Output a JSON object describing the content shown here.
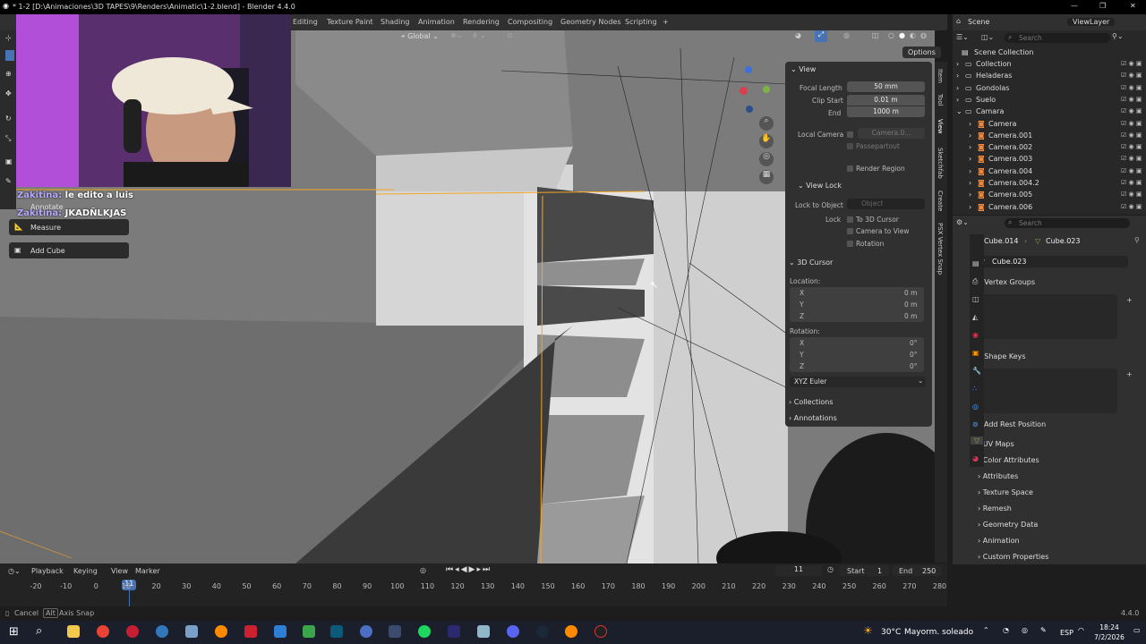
{
  "window": {
    "title": "* 1-2 [D:\\Animaciones\\3D TAPES\\9\\Renders\\Animatic\\1-2.blend] - Blender 4.4.0"
  },
  "workspaces": [
    "Editing",
    "Texture Paint",
    "Shading",
    "Animation",
    "Rendering",
    "Compositing",
    "Geometry Nodes",
    "Scripting",
    "+"
  ],
  "scene": {
    "name": "Scene",
    "view_layer": "ViewLayer"
  },
  "viewport": {
    "transform_orientation": "Global",
    "options_label": "Options"
  },
  "chat": [
    {
      "user": "Zakitina:",
      "msg": "le edito a luis"
    },
    {
      "user": "Zakitina:",
      "msg": "JKADÑLKJAS"
    }
  ],
  "tools": {
    "annotate": "Annotate",
    "measure": "Measure",
    "add_cube": "Add Cube"
  },
  "npanel": {
    "view_title": "View",
    "focal_length_label": "Focal Length",
    "focal_length": "50 mm",
    "clip_start_label": "Clip Start",
    "clip_start": "0.01 m",
    "end_label": "End",
    "end": "1000 m",
    "local_camera_label": "Local Camera",
    "local_camera": "Camera.0...",
    "passepartout": "Passepartout",
    "render_region": "Render Region",
    "view_lock_title": "View Lock",
    "lock_to_object_label": "Lock to Object",
    "lock_to_object": "Object",
    "lock_label": "Lock",
    "to_3d_cursor": "To 3D Cursor",
    "camera_to_view": "Camera to View",
    "rotation": "Rotation",
    "cursor_title": "3D Cursor",
    "location_label": "Location:",
    "loc": [
      {
        "axis": "X",
        "val": "0 m"
      },
      {
        "axis": "Y",
        "val": "0 m"
      },
      {
        "axis": "Z",
        "val": "0 m"
      }
    ],
    "rotation_label": "Rotation:",
    "rot": [
      {
        "axis": "X",
        "val": "0°"
      },
      {
        "axis": "Y",
        "val": "0°"
      },
      {
        "axis": "Z",
        "val": "0°"
      }
    ],
    "euler": "XYZ Euler",
    "collections": "Collections",
    "annotations": "Annotations"
  },
  "side_tabs": [
    "Item",
    "Tool",
    "View",
    "Sketchfab",
    "Create",
    "PSX Vertex Snap"
  ],
  "outliner": {
    "search_placeholder": "Search",
    "root": "Scene Collection",
    "items": [
      {
        "name": "Collection",
        "indent": 1
      },
      {
        "name": "Heladeras",
        "indent": 1
      },
      {
        "name": "Gondolas",
        "indent": 1
      },
      {
        "name": "Suelo",
        "indent": 1
      },
      {
        "name": "Camara",
        "indent": 1
      },
      {
        "name": "Camera",
        "indent": 2
      },
      {
        "name": "Camera.001",
        "indent": 2
      },
      {
        "name": "Camera.002",
        "indent": 2
      },
      {
        "name": "Camera.003",
        "indent": 2
      },
      {
        "name": "Camera.004",
        "indent": 2
      },
      {
        "name": "Camera.004.2",
        "indent": 2
      },
      {
        "name": "Camera.005",
        "indent": 2
      },
      {
        "name": "Camera.006",
        "indent": 2
      }
    ]
  },
  "properties": {
    "search_placeholder": "Search",
    "object": "Cube.014",
    "mesh": "Cube.023",
    "data_name": "Cube.023",
    "vertex_groups": "Vertex Groups",
    "shape_keys": "Shape Keys",
    "add_rest_position": "Add Rest Position",
    "sections": [
      "UV Maps",
      "Color Attributes",
      "Attributes",
      "Texture Space",
      "Remesh",
      "Geometry Data",
      "Animation",
      "Custom Properties"
    ]
  },
  "timeline": {
    "menus": [
      "Playback",
      "Keying",
      "View",
      "Marker"
    ],
    "current_frame": "11",
    "start_label": "Start",
    "start": "1",
    "end_label": "End",
    "end": "250",
    "ticks": [
      "-20",
      "-10",
      "0",
      "10",
      "20",
      "30",
      "40",
      "50",
      "60",
      "70",
      "80",
      "90",
      "100",
      "110",
      "120",
      "130",
      "140",
      "150",
      "160",
      "170",
      "180",
      "190",
      "200",
      "210",
      "220",
      "230",
      "240",
      "250",
      "260",
      "270",
      "280"
    ],
    "playhead_label": "11"
  },
  "status": {
    "cancel": "Cancel",
    "alt": "Alt",
    "axis_snap": "Axis Snap",
    "version": "4.4.0"
  },
  "taskbar": {
    "weather_temp": "30°C",
    "weather_desc": "Mayorm. soleado",
    "lang": "ESP",
    "time": "18:24",
    "date": "7/2/2026"
  },
  "colors": {
    "accent": "#4772b3",
    "selection_orange": "#f5a623",
    "panel": "#303030",
    "viewport": "#7a7a7a"
  }
}
